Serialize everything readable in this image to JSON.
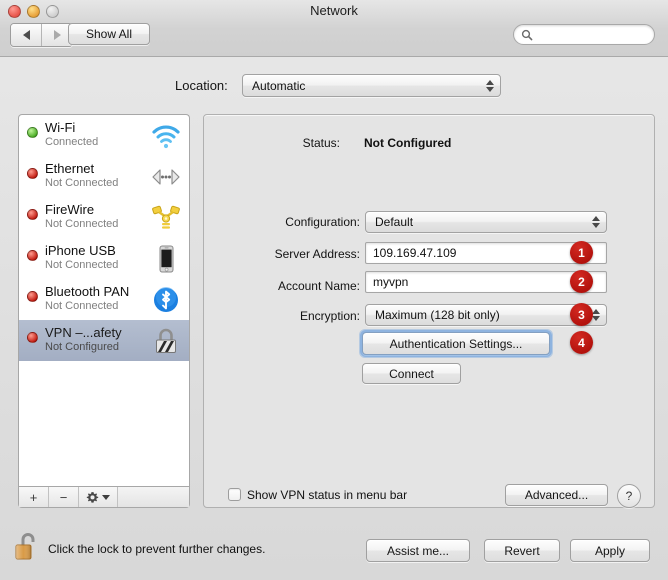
{
  "window": {
    "title": "Network",
    "traffic_lights": [
      "close",
      "minimize",
      "zoom"
    ]
  },
  "toolbar": {
    "back_label": "◀",
    "forward_label": "▶",
    "show_all_label": "Show All",
    "search_placeholder": "",
    "search_value": ""
  },
  "location": {
    "label": "Location:",
    "value": "Automatic"
  },
  "sidebar": {
    "services": [
      {
        "name": "Wi-Fi",
        "status": "Connected",
        "dot": "green",
        "icon": "wifi-icon",
        "selected": false
      },
      {
        "name": "Ethernet",
        "status": "Not Connected",
        "dot": "red",
        "icon": "ethernet-icon",
        "selected": false
      },
      {
        "name": "FireWire",
        "status": "Not Connected",
        "dot": "red",
        "icon": "firewire-icon",
        "selected": false
      },
      {
        "name": "iPhone USB",
        "status": "Not Connected",
        "dot": "red",
        "icon": "iphone-icon",
        "selected": false
      },
      {
        "name": "Bluetooth PAN",
        "status": "Not Connected",
        "dot": "red",
        "icon": "bluetooth-icon",
        "selected": false
      },
      {
        "name": "VPN –...afety",
        "status": "Not Configured",
        "dot": "red",
        "icon": "vpn-lock-icon",
        "selected": true
      }
    ],
    "footer": {
      "add_label": "+",
      "remove_label": "−",
      "gear_label": "gear-icon"
    }
  },
  "panel": {
    "status_label": "Status:",
    "status_value": "Not Configured",
    "configuration_label": "Configuration:",
    "configuration_value": "Default",
    "server_address_label": "Server Address:",
    "server_address_value": "109.169.47.109",
    "account_name_label": "Account Name:",
    "account_name_value": "myvpn",
    "encryption_label": "Encryption:",
    "encryption_value": "Maximum (128 bit only)",
    "auth_settings_label": "Authentication Settings...",
    "connect_label": "Connect",
    "show_status_label": "Show VPN status in menu bar",
    "show_status_checked": false,
    "advanced_label": "Advanced...",
    "help_label": "?"
  },
  "annotations": {
    "badge_color": "#b3120d",
    "items": [
      {
        "number": "1",
        "target": "server-address-field"
      },
      {
        "number": "2",
        "target": "account-name-field"
      },
      {
        "number": "3",
        "target": "encryption-popup"
      },
      {
        "number": "4",
        "target": "authentication-settings-button"
      }
    ]
  },
  "footer": {
    "lock_icon": "unlocked-padlock-icon",
    "lock_text": "Click the lock to prevent further changes.",
    "assist_label": "Assist me...",
    "revert_label": "Revert",
    "apply_label": "Apply"
  }
}
